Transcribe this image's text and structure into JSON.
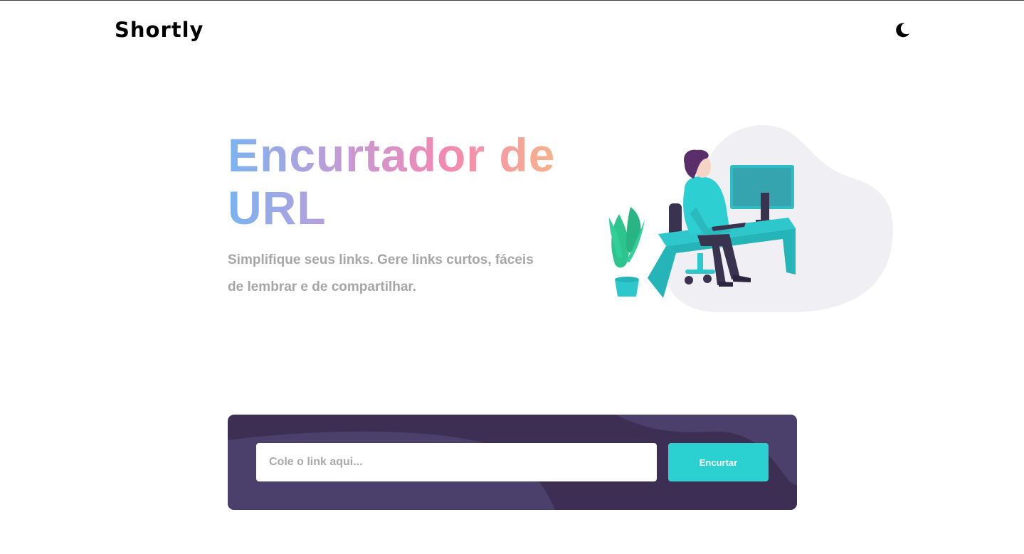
{
  "header": {
    "logo": "Shortly",
    "theme_icon": "moon-icon"
  },
  "hero": {
    "title_line1": "Encurtador de",
    "title_line2": "URL",
    "subtitle": "Simplifique seus links. Gere links curtos, fáceis de lembrar e de compartilhar.",
    "illustration": "person-working-at-desk-illustration"
  },
  "shorten": {
    "placeholder": "Cole o link aqui...",
    "value": "",
    "button_label": "Encurtar"
  },
  "colors": {
    "accent": "#2bd0d0",
    "panel": "#3c2f53",
    "panel_shape": "#4b3f6b",
    "muted_text": "#a6a6a6",
    "gradient_start": "#7ab3f2",
    "gradient_end": "#f6b48a"
  }
}
